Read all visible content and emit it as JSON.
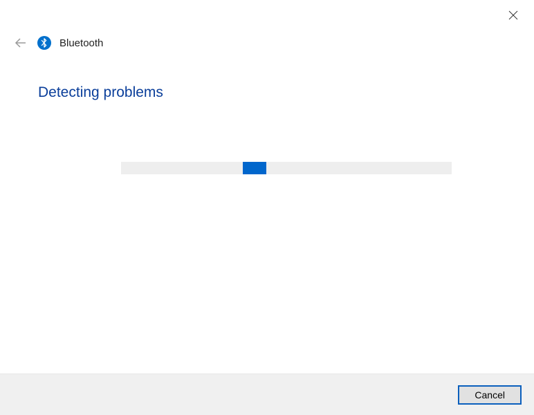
{
  "header": {
    "title": "Bluetooth"
  },
  "content": {
    "heading": "Detecting problems"
  },
  "footer": {
    "cancel_label": "Cancel"
  }
}
